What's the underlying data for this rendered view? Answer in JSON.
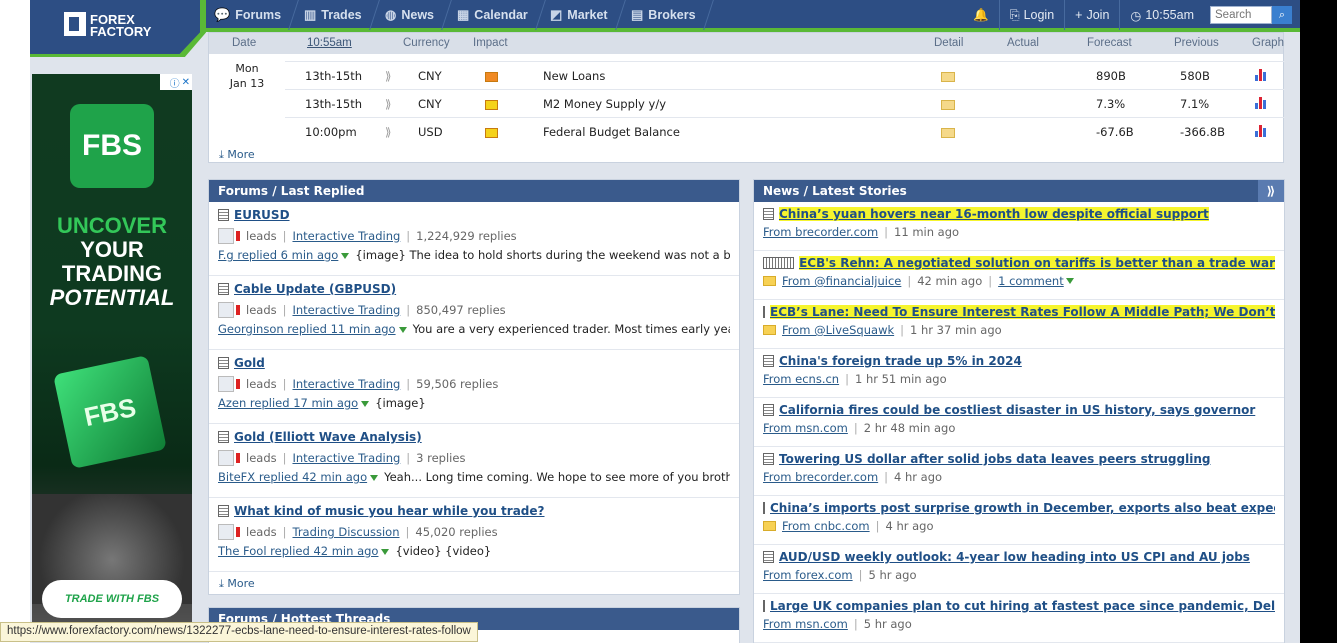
{
  "header": {
    "logo_line1": "FOREX",
    "logo_line2": "FACTORY",
    "nav": [
      {
        "label": "Forums",
        "icon": "chat-icon"
      },
      {
        "label": "Trades",
        "icon": "bars-icon"
      },
      {
        "label": "News",
        "icon": "globe-icon"
      },
      {
        "label": "Calendar",
        "icon": "calendar-icon"
      },
      {
        "label": "Market",
        "icon": "chart-icon"
      },
      {
        "label": "Brokers",
        "icon": "broker-icon"
      }
    ],
    "login": "Login",
    "join": "Join",
    "time": "10:55am",
    "search_placeholder": "Search"
  },
  "calendar": {
    "columns": {
      "date": "Date",
      "time": "10:55am",
      "currency": "Currency",
      "impact": "Impact",
      "detail": "Detail",
      "actual": "Actual",
      "forecast": "Forecast",
      "previous": "Previous",
      "graph": "Graph"
    },
    "day": "Mon",
    "date": "Jan 13",
    "rows": [
      {
        "time": "13th-15th",
        "currency": "CNY",
        "impact": "orange",
        "event": "New Loans",
        "actual": "",
        "forecast": "890B",
        "previous": "580B"
      },
      {
        "time": "13th-15th",
        "currency": "CNY",
        "impact": "yellow",
        "event": "M2 Money Supply y/y",
        "actual": "",
        "forecast": "7.3%",
        "previous": "7.1%"
      },
      {
        "time": "10:00pm",
        "currency": "USD",
        "impact": "yellow",
        "event": "Federal Budget Balance",
        "actual": "",
        "forecast": "-67.6B",
        "previous": "-366.8B"
      }
    ],
    "more": "More"
  },
  "ad": {
    "brand": "FBS",
    "line1": "UNCOVER",
    "line2": "YOUR",
    "line3": "TRADING",
    "line4": "POTENTIAL",
    "cube_text": "FBS",
    "cta": "TRADE WITH FBS"
  },
  "forums": {
    "title": "Forums / Last Replied",
    "more": "More",
    "items": [
      {
        "title": "EURUSD",
        "leads": "leads",
        "category": "Interactive Trading",
        "replies": "1,224,929 replies",
        "replied_by": "F.g replied 6 min ago",
        "snippet": "{image} The idea to hold shorts during the weekend was not a ba"
      },
      {
        "title": "Cable Update (GBPUSD)",
        "leads": "leads",
        "category": "Interactive Trading",
        "replies": "850,497 replies",
        "replied_by": "Georginson replied 11 min ago",
        "snippet": "You are a very experienced trader. Most times early year"
      },
      {
        "title": "Gold",
        "leads": "leads",
        "category": "Interactive Trading",
        "replies": "59,506 replies",
        "replied_by": "Azen replied 17 min ago",
        "snippet": "{image}"
      },
      {
        "title": "Gold (Elliott Wave Analysis)",
        "leads": "leads",
        "category": "Interactive Trading",
        "replies": "3 replies",
        "replied_by": "BiteFX replied 42 min ago",
        "snippet": "Yeah... Long time coming. We hope to see more of you brothe"
      },
      {
        "title": "What kind of music you hear while you trade?",
        "leads": "leads",
        "category": "Trading Discussion",
        "replies": "45,020 replies",
        "replied_by": "The Fool replied 42 min ago",
        "snippet": "{video} {video}"
      }
    ],
    "next_title": "Forums / Hottest Threads"
  },
  "news": {
    "title": "News / Latest Stories",
    "items": [
      {
        "title": "China’s yuan hovers near 16-month low despite official support",
        "source": "From brecorder.com",
        "age": "11 min ago",
        "comment": "",
        "highlight": true,
        "multi": false,
        "folder": false
      },
      {
        "title": "ECB's Rehn: A negotiated solution on tariffs is better than a trade war",
        "source": "From @financialjuice",
        "age": "42 min ago",
        "comment": "1 comment",
        "highlight": true,
        "multi": true,
        "folder": true
      },
      {
        "title": "ECB’s Lane: Need To Ensure Interest Rates Follow A Middle Path; We Don’t Wa",
        "source": "From @LiveSquawk",
        "age": "1 hr 37 min ago",
        "comment": "",
        "highlight": true,
        "multi": false,
        "folder": true
      },
      {
        "title": "China's foreign trade up 5% in 2024",
        "source": "From ecns.cn",
        "age": "1 hr 51 min ago",
        "comment": "",
        "highlight": false,
        "multi": false,
        "folder": false
      },
      {
        "title": "California fires could be costliest disaster in US history, says governor",
        "source": "From msn.com",
        "age": "2 hr 48 min ago",
        "comment": "",
        "highlight": false,
        "multi": false,
        "folder": false
      },
      {
        "title": "Towering US dollar after solid jobs data leaves peers struggling",
        "source": "From brecorder.com",
        "age": "4 hr ago",
        "comment": "",
        "highlight": false,
        "multi": false,
        "folder": false
      },
      {
        "title": "China’s imports post surprise growth in December, exports also beat expectati",
        "source": "From cnbc.com",
        "age": "4 hr ago",
        "comment": "",
        "highlight": false,
        "multi": false,
        "folder": true
      },
      {
        "title": "AUD/USD weekly outlook: 4-year low heading into US CPI and AU jobs",
        "source": "From forex.com",
        "age": "5 hr ago",
        "comment": "",
        "highlight": false,
        "multi": false,
        "folder": false
      },
      {
        "title": "Large UK companies plan to cut hiring at fastest pace since pandemic, Deloitte",
        "source": "From msn.com",
        "age": "5 hr ago",
        "comment": "",
        "highlight": false,
        "multi": false,
        "folder": false
      }
    ]
  },
  "status_url": "https://www.forexfactory.com/news/1322277-ecbs-lane-need-to-ensure-interest-rates-follow"
}
